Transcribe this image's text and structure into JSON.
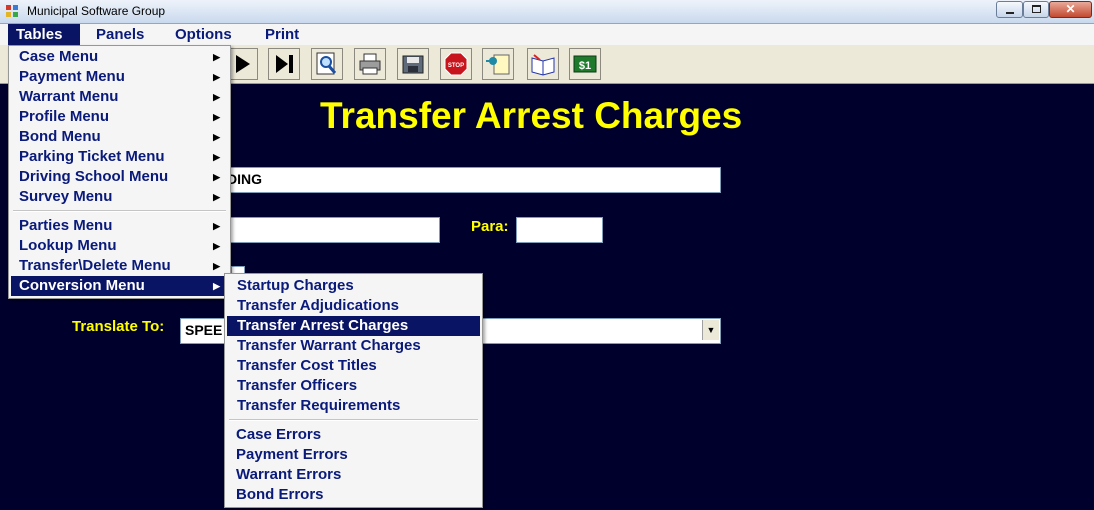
{
  "window": {
    "title": "Municipal Software Group"
  },
  "menubar": {
    "items": [
      "Tables",
      "Panels",
      "Options",
      "Print"
    ]
  },
  "toolbar": {
    "buttons": [
      "play-icon",
      "skip-to-end-icon",
      "preview-magnifier-icon",
      "printer-icon",
      "save-disk-icon",
      "stop-sign-icon",
      "pin-note-icon",
      "open-book-icon",
      "dollar-bill-icon"
    ],
    "stop_text": "STOP",
    "dollar_text": "$1"
  },
  "main": {
    "title": "Transfer Arrest Charges",
    "field1_value": "DING",
    "para_label": "Para:",
    "para_value": "",
    "field2_value": "",
    "translate_label": "Translate To:",
    "translate_value": "SPEE"
  },
  "tables_menu": {
    "group1": [
      "Case Menu",
      "Payment Menu",
      "Warrant Menu",
      "Profile Menu",
      "Bond Menu",
      "Parking Ticket Menu",
      "Driving School Menu",
      "Survey Menu"
    ],
    "group2": [
      "Parties Menu",
      "Lookup Menu",
      "Transfer\\Delete Menu",
      "Conversion Menu"
    ],
    "highlighted": "Conversion Menu"
  },
  "conversion_menu": {
    "group1": [
      "Startup Charges",
      "Transfer Adjudications",
      "Transfer Arrest Charges",
      "Transfer Warrant Charges",
      "Transfer Cost Titles",
      "Transfer Officers",
      "Transfer Requirements"
    ],
    "group2": [
      "Case Errors",
      "Payment Errors",
      "Warrant Errors",
      "Bond Errors"
    ],
    "highlighted": "Transfer Arrest Charges"
  },
  "colors": {
    "panel_bg": "#00002c",
    "title_yellow": "#ffff00",
    "menu_text": "#0a1a7a",
    "highlight": "#0a1464"
  }
}
